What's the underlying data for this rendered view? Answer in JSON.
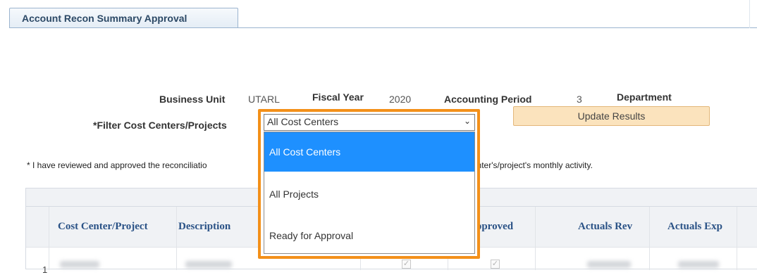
{
  "tab": {
    "label": "Account Recon Summary Approval"
  },
  "filters": {
    "business_unit_label": "Business Unit",
    "business_unit_value": "UTARL",
    "fiscal_year_label": "Fiscal Year",
    "fiscal_year_value": "2020",
    "accounting_period_label": "Accounting Period",
    "accounting_period_value": "3",
    "department_label": "Department",
    "filter_label": "*Filter Cost Centers/Projects",
    "filter_selected": "All Cost Centers",
    "update_button": "Update Results"
  },
  "dropdown": {
    "options": [
      "All Cost Centers",
      "All Projects",
      "Ready for Approval"
    ],
    "highlighted": "All Cost Centers"
  },
  "note": {
    "left": "* I have reviewed and approved the reconciliatio",
    "right": "or this cost center's/project's monthly activity."
  },
  "grid": {
    "columns": [
      "Cost Center/Project",
      "Description",
      "pproved",
      "Actuals Rev",
      "Actuals Exp"
    ],
    "rows": [
      {
        "num": "1"
      }
    ]
  },
  "colors": {
    "highlight_border": "#f39019",
    "selected_option": "#1e90ff",
    "button_bg": "#fbe3bd"
  }
}
